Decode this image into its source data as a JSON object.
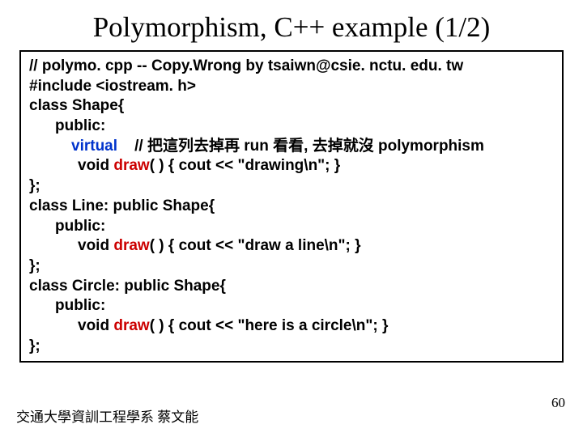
{
  "title": "Polymorphism, C++ example (1/2)",
  "code": {
    "l1": "// polymo. cpp -- Copy.Wrong by tsaiwn@csie. nctu. edu. tw",
    "l2": "#include <iostream. h>",
    "l3": "class Shape{",
    "l4": "public:",
    "l5a": "virtual",
    "l5b": "// 把這列去掉再 run 看看, 去掉就沒 polymorphism",
    "l6a": "void ",
    "l6b": "draw",
    "l6c": "( ) { cout << \"drawing\\n\"; }",
    "l7": "};",
    "l8": "class Line: public Shape{",
    "l9": "public:",
    "l10a": "void ",
    "l10b": "draw",
    "l10c": "( ) { cout << \"draw a line\\n\"; }",
    "l11": "};",
    "l12": "class Circle: public Shape{",
    "l13": "public:",
    "l14a": "void ",
    "l14b": "draw",
    "l14c": "( ) { cout << \"here is a circle\\n\"; }",
    "l15": "};"
  },
  "footer": "交通大學資訓工程學系 蔡文能",
  "pagenum": "60"
}
